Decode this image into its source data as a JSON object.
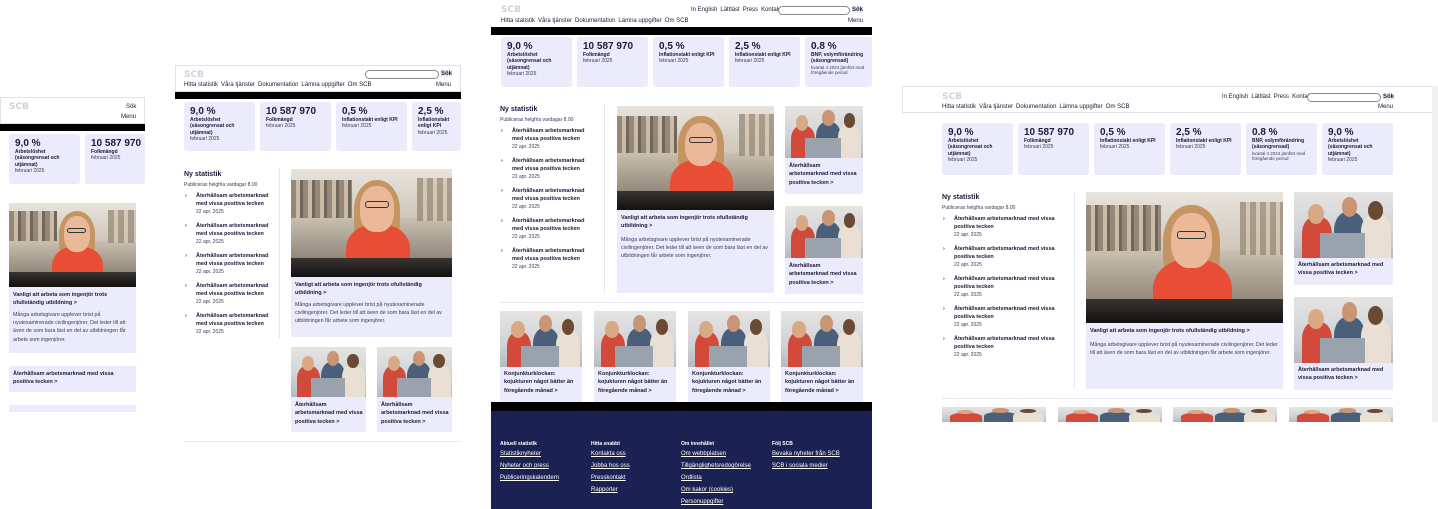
{
  "site": {
    "logo": "SCB",
    "nav": [
      "Hitta statistik",
      "Våra tjänster",
      "Dokumentation",
      "Lämna uppgifter",
      "Om SCB"
    ],
    "top_links": [
      "In English",
      "Lättläst",
      "Press",
      "Kontakt"
    ],
    "search_label": "Sök",
    "menu_label": "Menu"
  },
  "stats": [
    {
      "value": "9,0 %",
      "label": "Arbetslöshet (säsongrensat och utjämnat)",
      "date": "februari 2025"
    },
    {
      "value": "10 587 970",
      "label": "Folkmängd",
      "date": "februari 2025"
    },
    {
      "value": "0,5 %",
      "label": "Inflationstakt enligt KPI",
      "date": "februari 2025"
    },
    {
      "value": "2,5 %",
      "label": "Inflationstakt enligt KPI",
      "date": "februari 2025"
    },
    {
      "value": "0.8 %",
      "label": "BNP, volymförändring (säsongrensad)",
      "date": "kvartal 4 2024 jämfört med föregående period"
    },
    {
      "value": "9,0 %",
      "label": "Arbetslöshet (säsongrensat och utjämnat)",
      "date": "februari 2025"
    }
  ],
  "news": {
    "heading": "Ny statistik",
    "sub": "Publiceras helgfria vardagar 8.00",
    "items": [
      {
        "title": "Återhållsam arbetsmarknad med vissa positiva tecken",
        "date": "22 apr. 2025"
      },
      {
        "title": "Återhållsam arbetsmarknad med vissa positiva tecken",
        "date": "22 apr. 2025"
      },
      {
        "title": "Återhållsam arbetsmarknad med vissa positiva tecken",
        "date": "22 apr. 2025"
      },
      {
        "title": "Återhållsam arbetsmarknad med vissa positiva tecken",
        "date": "22 apr. 2025"
      },
      {
        "title": "Återhållsam arbetsmarknad med vissa positiva tecken",
        "date": "22 apr. 2025"
      }
    ]
  },
  "feature": {
    "title": "Vanligt att arbeta som ingenjör trots ofullständig utbildning >",
    "text": "Många arbetsgivare upplever brist på nyutexaminerade civilingenjörer. Det leder till att även de som bara läst en del av utbildningen får arbete som ingenjörer."
  },
  "side_card": {
    "title": "Återhållsam arbetsmarknad med vissa positiva tecken >"
  },
  "konj_card": {
    "title": "Konjunkturklockan: kojukturen något bätter än föregående månad >"
  },
  "footer": {
    "columns": [
      {
        "heading": "Aktuell statistik",
        "links": [
          "Statistiknyheter",
          "Nyheter och press",
          "Publiceringskalendern"
        ]
      },
      {
        "heading": "Hitta snabbt",
        "links": [
          "Kontakta oss",
          "Jobba hos oss",
          "Presskontakt",
          "Rapporter"
        ]
      },
      {
        "heading": "Om innehållet",
        "links": [
          "Om webbplatsen",
          "Tillgänglighetsredogörelse",
          "Ordlista",
          "Om kakor (cookies)",
          "Personuppgifter"
        ]
      },
      {
        "heading": "Följ SCB",
        "links": [
          "Bevaka nyheter från SCB",
          "SCB i sociala medier"
        ]
      }
    ]
  },
  "colors": {
    "card_bg": "#ecebfc",
    "footer_bg": "#1b2153",
    "text": "#1a1a3a"
  }
}
